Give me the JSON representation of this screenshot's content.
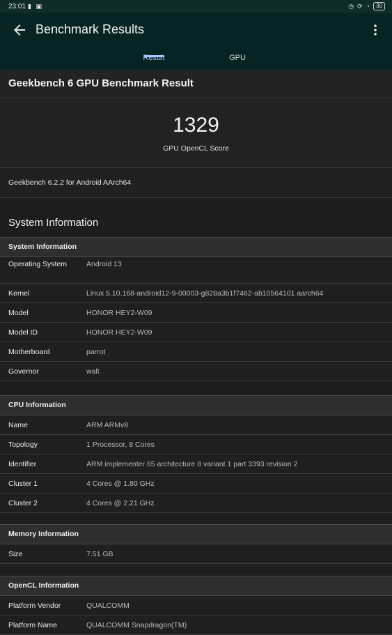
{
  "status_bar": {
    "time": "23:01",
    "battery": "30"
  },
  "app_bar": {
    "title": "Benchmark Results"
  },
  "tabs": [
    {
      "label": "Result",
      "selected": true
    },
    {
      "label": "GPU",
      "selected": false
    }
  ],
  "result": {
    "page_title": "Geekbench 6 GPU Benchmark Result",
    "score": "1329",
    "score_label": "GPU OpenCL Score",
    "version": "Geekbench 6.2.2 for Android AArch64"
  },
  "system_information_heading": "System Information",
  "sections": {
    "system": {
      "title": "System Information",
      "rows": [
        {
          "label": "Operating System",
          "value": "Android 13"
        },
        {
          "label": "Kernel",
          "value": "Linux 5.10.168-android12-9-00003-g828a3b1f7462-ab10564101 aarch64"
        },
        {
          "label": "Model",
          "value": "HONOR HEY2-W09"
        },
        {
          "label": "Model ID",
          "value": "HONOR HEY2-W09"
        },
        {
          "label": "Motherboard",
          "value": "parrot"
        },
        {
          "label": "Governor",
          "value": "walt"
        }
      ]
    },
    "cpu": {
      "title": "CPU Information",
      "rows": [
        {
          "label": "Name",
          "value": "ARM ARMv8"
        },
        {
          "label": "Topology",
          "value": "1 Processor, 8 Cores"
        },
        {
          "label": "Identifier",
          "value": "ARM implementer 65 architecture 8 variant 1 part 3393 revision 2"
        },
        {
          "label": "Cluster 1",
          "value": "4 Cores @ 1.80 GHz"
        },
        {
          "label": "Cluster 2",
          "value": "4 Cores @ 2.21 GHz"
        }
      ]
    },
    "memory": {
      "title": "Memory Information",
      "rows": [
        {
          "label": "Size",
          "value": "7.51 GB"
        }
      ]
    },
    "opencl": {
      "title": "OpenCL Information",
      "rows": [
        {
          "label": "Platform Vendor",
          "value": "QUALCOMM"
        },
        {
          "label": "Platform Name",
          "value": "QUALCOMM Snapdragon(TM)"
        }
      ]
    }
  },
  "colors": {
    "app_bar": "#062424",
    "status_bar": "#0f2c2b",
    "tab_accent": "#a9c7ff",
    "background": "#1d1d1d"
  }
}
